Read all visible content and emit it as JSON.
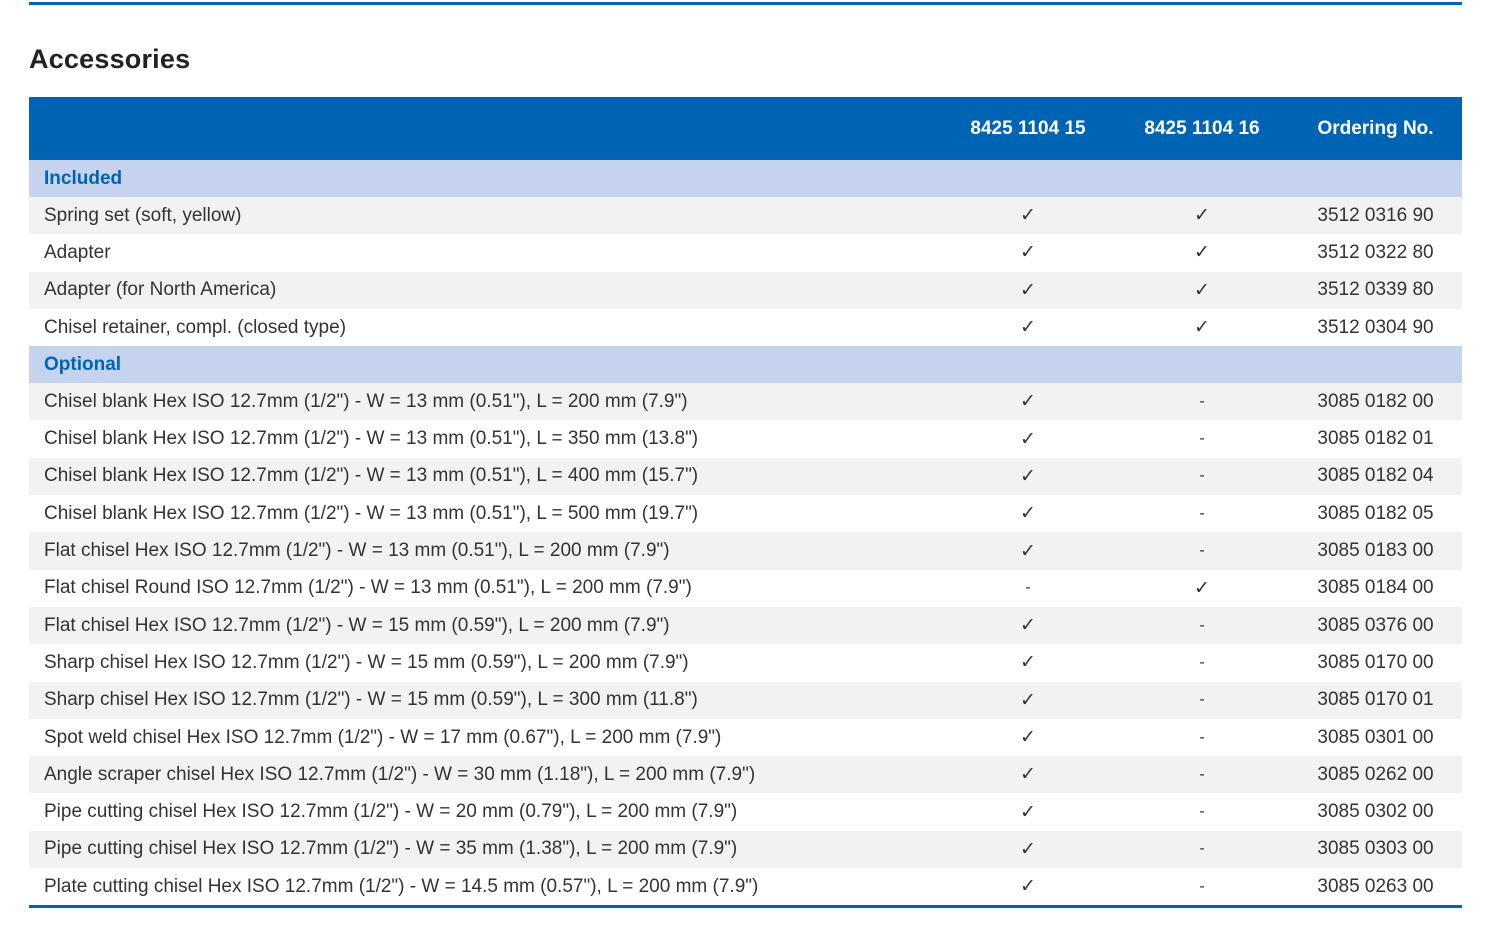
{
  "title": "Accessories",
  "colors": {
    "header_bg": "#0064b4",
    "group_bg": "#c5d3ee",
    "group_text": "#0064b4",
    "row_alt_bg": "#f2f2f2",
    "mark_color": "#19a7c5"
  },
  "table": {
    "headers": [
      "",
      "8425 1104 15",
      "8425 1104 16",
      "Ordering No."
    ],
    "groups": [
      {
        "label": "Included",
        "rows": [
          {
            "desc": "Spring set (soft, yellow)",
            "m1": "✓",
            "m2": "✓",
            "ord": "3512 0316 90"
          },
          {
            "desc": "Adapter",
            "m1": "✓",
            "m2": "✓",
            "ord": "3512 0322 80"
          },
          {
            "desc": "Adapter (for North America)",
            "m1": "✓",
            "m2": "✓",
            "ord": "3512 0339 80"
          },
          {
            "desc": "Chisel retainer, compl. (closed type)",
            "m1": "✓",
            "m2": "✓",
            "ord": "3512 0304 90"
          }
        ]
      },
      {
        "label": "Optional",
        "rows": [
          {
            "desc": "Chisel blank Hex ISO 12.7mm (1/2\") - W = 13 mm (0.51\"), L = 200 mm (7.9\")",
            "m1": "✓",
            "m2": "-",
            "ord": "3085 0182 00"
          },
          {
            "desc": "Chisel blank Hex ISO 12.7mm (1/2\") - W = 13 mm (0.51\"), L = 350 mm (13.8\")",
            "m1": "✓",
            "m2": "-",
            "ord": "3085 0182 01"
          },
          {
            "desc": "Chisel blank Hex ISO 12.7mm (1/2\") - W = 13 mm (0.51\"), L = 400 mm (15.7\")",
            "m1": "✓",
            "m2": "-",
            "ord": "3085 0182 04"
          },
          {
            "desc": "Chisel blank Hex ISO 12.7mm (1/2\") - W = 13 mm (0.51\"), L = 500 mm (19.7\")",
            "m1": "✓",
            "m2": "-",
            "ord": "3085 0182 05"
          },
          {
            "desc": "Flat chisel Hex ISO 12.7mm (1/2\") - W = 13 mm (0.51\"), L = 200 mm (7.9\")",
            "m1": "✓",
            "m2": "-",
            "ord": "3085 0183 00"
          },
          {
            "desc": "Flat chisel Round ISO 12.7mm (1/2\") - W = 13 mm (0.51\"), L = 200 mm (7.9\")",
            "m1": "-",
            "m2": "✓",
            "ord": "3085 0184 00"
          },
          {
            "desc": "Flat chisel Hex ISO 12.7mm (1/2\") - W = 15 mm (0.59\"), L = 200 mm (7.9\")",
            "m1": "✓",
            "m2": "-",
            "ord": "3085 0376 00"
          },
          {
            "desc": "Sharp chisel Hex ISO 12.7mm (1/2\") - W = 15 mm (0.59\"), L = 200 mm (7.9\")",
            "m1": "✓",
            "m2": "-",
            "ord": "3085 0170 00"
          },
          {
            "desc": "Sharp chisel Hex ISO 12.7mm (1/2\") - W = 15 mm (0.59\"), L = 300 mm (11.8\")",
            "m1": "✓",
            "m2": "-",
            "ord": "3085 0170 01"
          },
          {
            "desc": "Spot weld chisel Hex ISO 12.7mm (1/2\") - W = 17 mm (0.67\"), L = 200 mm (7.9\")",
            "m1": "✓",
            "m2": "-",
            "ord": "3085 0301 00"
          },
          {
            "desc": "Angle scraper chisel Hex ISO 12.7mm (1/2\") - W = 30 mm (1.18\"), L = 200 mm (7.9\")",
            "m1": "✓",
            "m2": "-",
            "ord": "3085 0262 00"
          },
          {
            "desc": "Pipe cutting chisel Hex ISO 12.7mm (1/2\") - W = 20 mm (0.79\"), L = 200 mm (7.9\")",
            "m1": "✓",
            "m2": "-",
            "ord": "3085 0302 00"
          },
          {
            "desc": "Pipe cutting chisel Hex ISO 12.7mm (1/2\") - W = 35 mm (1.38\"), L = 200 mm (7.9\")",
            "m1": "✓",
            "m2": "-",
            "ord": "3085 0303 00"
          },
          {
            "desc": "Plate cutting chisel Hex ISO 12.7mm (1/2\") - W = 14.5 mm (0.57\"), L = 200 mm (7.9\")",
            "m1": "✓",
            "m2": "-",
            "ord": "3085 0263 00"
          }
        ]
      }
    ]
  }
}
